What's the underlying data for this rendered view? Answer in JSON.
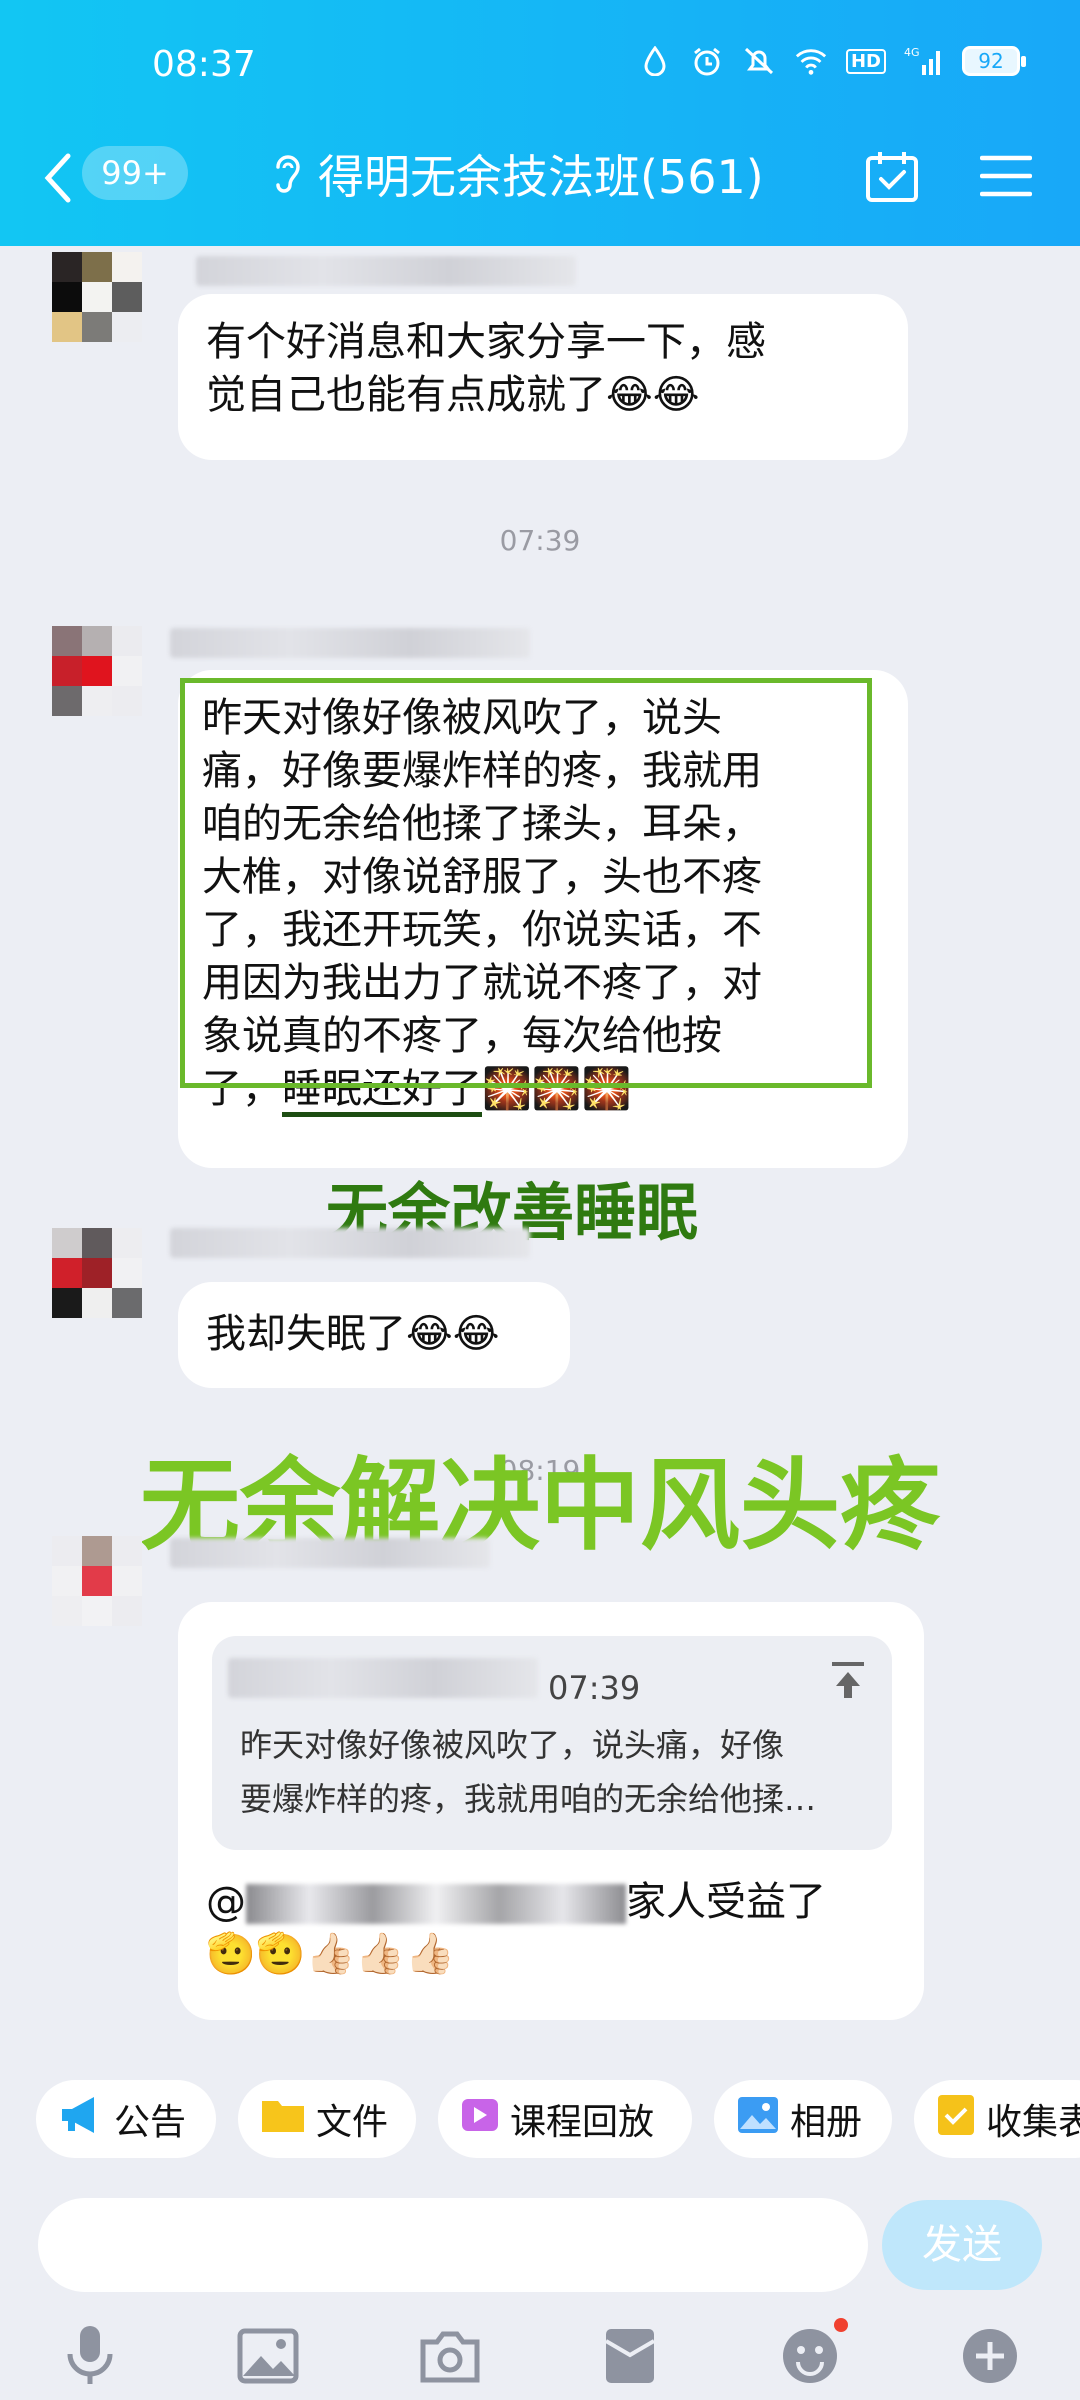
{
  "status": {
    "time": "08:37",
    "network": "4G",
    "hd": "HD",
    "battery": "92"
  },
  "nav": {
    "badge": "99+",
    "title": "得明无余技法班(561)"
  },
  "messages": {
    "m1": {
      "text1": "有个好消息和大家分享一下，感",
      "text2": "觉自己也能有点成就了😂😂"
    },
    "ts1": "07:39",
    "m2": {
      "lines": [
        "昨天对像好像被风吹了，说头",
        "痛，好像要爆炸样的疼，我就用",
        "咱的无余给他揉了揉头，耳朵，",
        "大椎，对像说舒服了，头也不疼",
        "了，我还开玩笑，你说实话，不",
        "用因为我出力了就说不疼了，对",
        "象说真的不疼了，每次给他按"
      ],
      "last_prefix": "了，",
      "last_underlined": "睡眠还好了",
      "last_suffix": "🎇🎇🎇"
    },
    "caption1": "无余改善睡眠",
    "m3": {
      "text": "我却失眠了😂😂"
    },
    "ts2": "08:19",
    "caption2": "无余解决中风头疼",
    "m4": {
      "quote_time": "07:39",
      "quote_line1": "昨天对像好像被风吹了，说头痛，好像",
      "quote_line2": "要爆炸样的疼，我就用咱的无余给他揉…",
      "reply_at": "@",
      "reply_text": "家人受益了",
      "reply_emojis": "🫡🫡👍🏻👍🏻👍🏻"
    }
  },
  "shortcuts": {
    "announce": "公告",
    "files": "文件",
    "replay": "课程回放",
    "album": "相册",
    "collect": "收集表"
  },
  "input": {
    "placeholder": "",
    "send": "发送"
  },
  "colors": {
    "header": "#18a8f8",
    "accent_green": "#6ab92b"
  }
}
